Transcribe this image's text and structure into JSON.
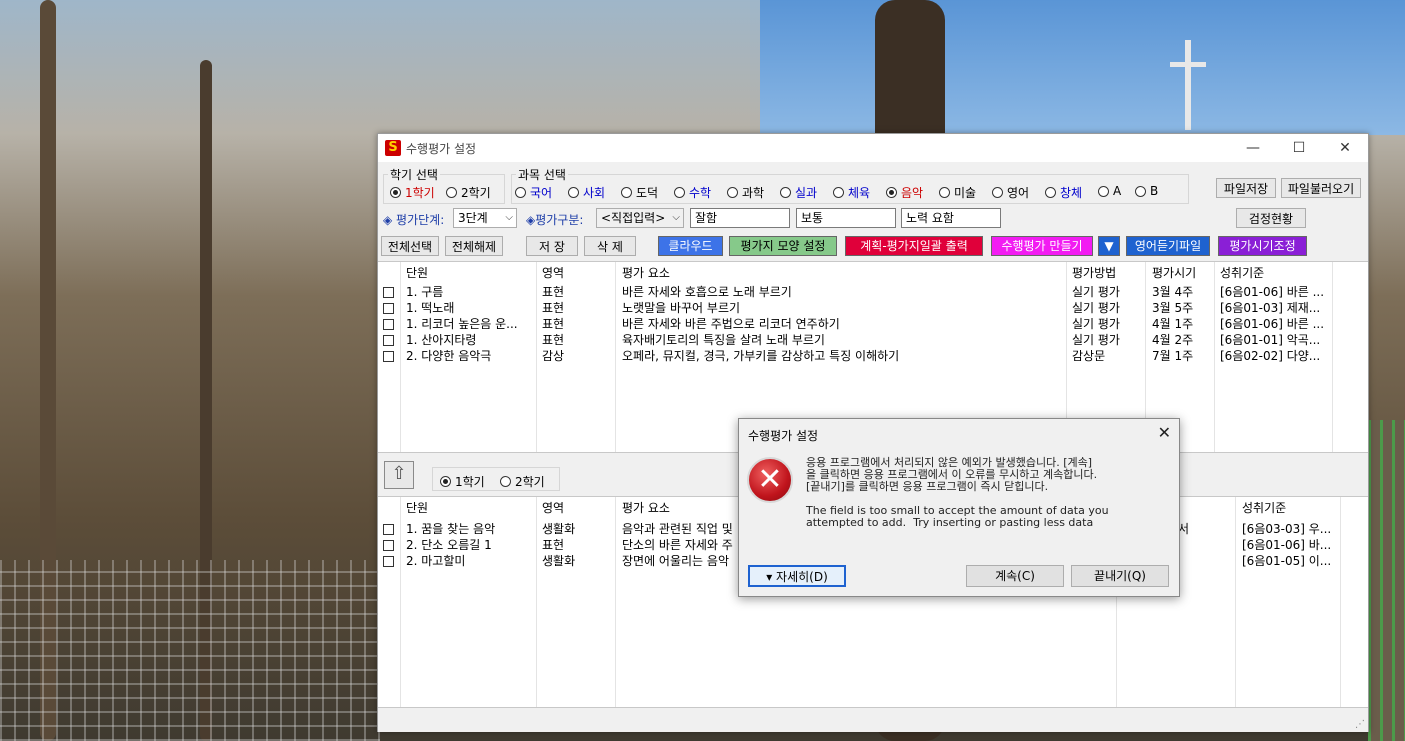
{
  "window": {
    "title": "수행평가 설정",
    "minimize": "—",
    "maximize": "☐",
    "close": "✕"
  },
  "semester_group": {
    "label": "학기 선택",
    "options": [
      "1학기",
      "2학기"
    ],
    "selected": "1학기"
  },
  "subject_group": {
    "label": "과목 선택",
    "options": [
      "국어",
      "사회",
      "도덕",
      "수학",
      "과학",
      "실과",
      "체육",
      "음악",
      "미술",
      "영어",
      "창체",
      "A",
      "B"
    ],
    "selected": "음악"
  },
  "file_buttons": {
    "save": "파일저장",
    "load": "파일불러오기"
  },
  "eval_stage": {
    "label": "◈ 평가단계:",
    "value": "3단계"
  },
  "eval_type": {
    "label": "◈평가구분:",
    "value": "<직접입력>"
  },
  "levels": [
    "잘함",
    "보통",
    "노력 요함"
  ],
  "check_status": "검정현황",
  "toolbar": {
    "select_all": "전체선택",
    "deselect_all": "전체해제",
    "save": "저 장",
    "delete": "삭 제",
    "cloud": "클라우드",
    "sheet_shape": "평가지 모양 설정",
    "plan_print": "계획-평가지일괄 출력",
    "make_eval": "수행평가 만들기",
    "dropdown": "▼",
    "english_listening": "영어듣기파일",
    "adjust_time": "평가시기조정"
  },
  "upper_table": {
    "headers": [
      "단원",
      "영역",
      "평가 요소",
      "평가방법",
      "평가시기",
      "성취기준"
    ],
    "rows": [
      [
        "1. 구름",
        "표현",
        "바른 자세와 호흡으로 노래 부르기",
        "실기 평가",
        "3월 4주",
        "[6음01-06] 바른 ..."
      ],
      [
        "1. 떡노래",
        "표현",
        "노랫말을 바꾸어 부르기",
        "실기 평가",
        "3월 5주",
        "[6음01-03] 제재..."
      ],
      [
        "1. 리코더 높은음 운...",
        "표현",
        "바른 자세와 바른 주법으로 리코더 연주하기",
        "실기 평가",
        "4월 1주",
        "[6음01-06] 바른 ..."
      ],
      [
        "1. 산아지타령",
        "표현",
        "육자배기토리의 특징을 살려 노래 부르기",
        "실기 평가",
        "4월 2주",
        "[6음01-01] 악곡..."
      ],
      [
        "2. 다양한 음악극",
        "감상",
        "오페라, 뮤지컬, 경극, 가부키를 감상하고 특징 이해하기",
        "감상문",
        "7월 1주",
        "[6음02-02] 다양..."
      ]
    ]
  },
  "lower_bar": {
    "up_icon": "up-arrow",
    "options": [
      "1학기",
      "2학기"
    ],
    "selected": "1학기"
  },
  "lower_table": {
    "headers": [
      "단원",
      "영역",
      "평가 요소",
      "성취기준"
    ],
    "rows": [
      [
        "1. 꿈을 찾는 음악",
        "생활화",
        "음악과 관련된 직업 및",
        "서",
        "[6음03-03] 우..."
      ],
      [
        "2. 단소 오름길 1",
        "표현",
        "단소의 바른 자세와 주",
        "",
        "[6음01-06] 바..."
      ],
      [
        "2. 마고할미",
        "생활화",
        "장면에 어울리는 음악",
        "",
        "[6음01-05] 이..."
      ]
    ]
  },
  "dialog": {
    "title": "수행평가 설정",
    "close": "✕",
    "message_ko": "응용 프로그램에서 처리되지 않은 예외가 발생했습니다. [계속]\n을 클릭하면 응용 프로그램에서 이 오류를 무시하고 계속합니다.\n[끝내기]를 클릭하면 응용 프로그램이 즉시 닫힙니다.",
    "message_en": "The field is too small to accept the amount of data you\nattempted to add.  Try inserting or pasting less data",
    "details": "▾ 자세히(D)",
    "continue": "계속(C)",
    "quit": "끝내기(Q)"
  },
  "colors": {
    "red_text": "#cc0000",
    "blue_text": "#0000cc",
    "accent": "#1e62d0"
  }
}
